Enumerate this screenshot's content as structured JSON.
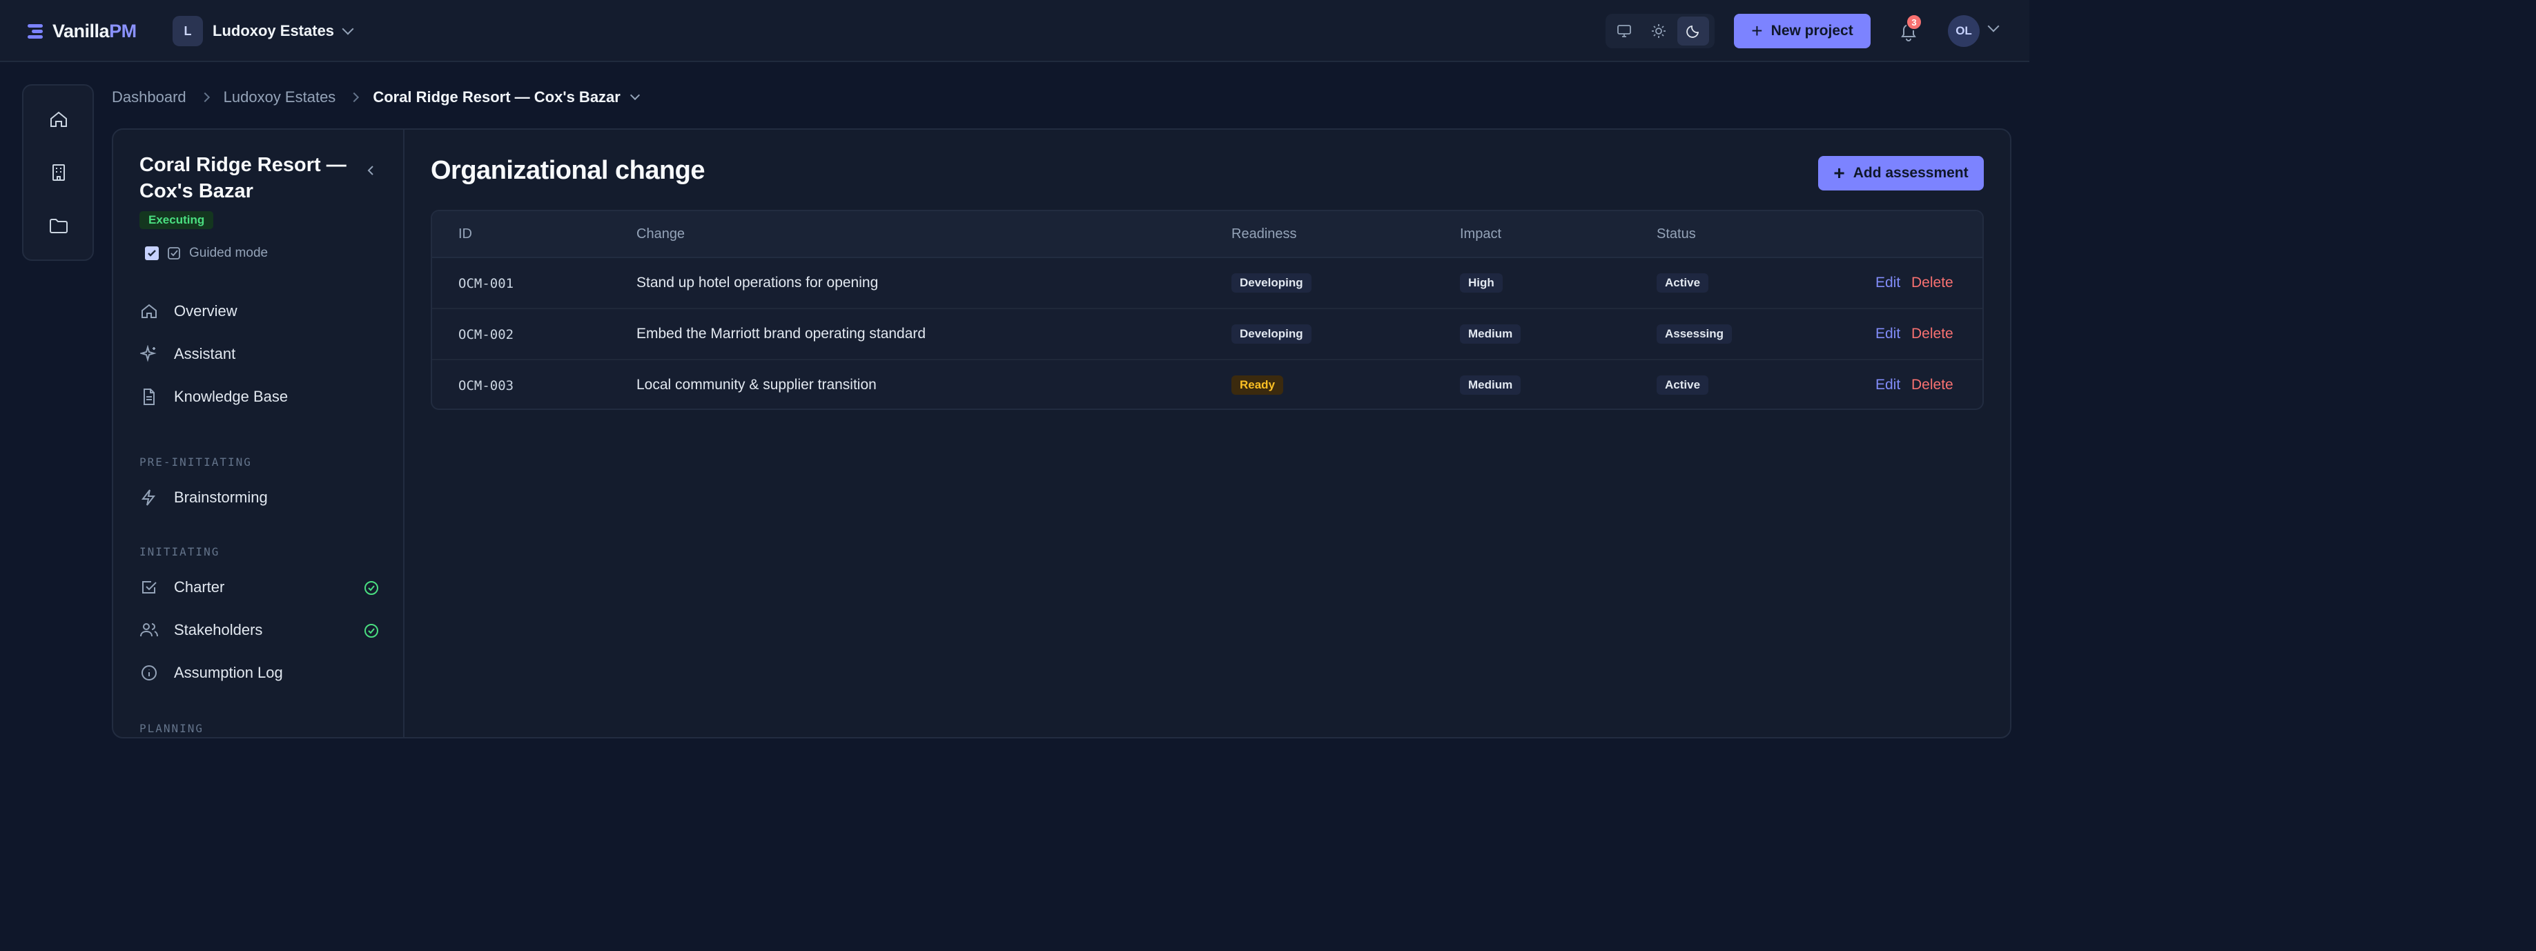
{
  "app": {
    "logo_main": "Vanilla",
    "logo_accent": "PM",
    "org_initial": "L",
    "org_name": "Ludoxoy Estates",
    "new_project_label": "New project",
    "notification_count": "3",
    "user_initials": "OL"
  },
  "breadcrumb": {
    "items": [
      "Dashboard",
      "Ludoxoy Estates"
    ],
    "current": "Coral Ridge Resort — Cox's Bazar"
  },
  "sidebar": {
    "project_title": "Coral Ridge Resort — Cox's Bazar",
    "phase": "Executing",
    "guided_mode_label": "Guided mode",
    "items": [
      {
        "label": "Overview",
        "icon": "home-icon"
      },
      {
        "label": "Assistant",
        "icon": "sparkles-icon"
      },
      {
        "label": "Knowledge Base",
        "icon": "document-icon"
      }
    ],
    "sections": [
      {
        "label": "PRE-INITIATING",
        "items": [
          {
            "label": "Brainstorming",
            "icon": "lightning-icon"
          }
        ]
      },
      {
        "label": "INITIATING",
        "items": [
          {
            "label": "Charter",
            "icon": "checkbox-icon",
            "done": true
          },
          {
            "label": "Stakeholders",
            "icon": "users-icon",
            "done": true
          },
          {
            "label": "Assumption Log",
            "icon": "info-icon"
          }
        ]
      },
      {
        "label": "PLANNING",
        "items": []
      }
    ]
  },
  "main": {
    "title": "Organizational change",
    "add_button_label": "Add assessment",
    "columns": [
      "ID",
      "Change",
      "Readiness",
      "Impact",
      "Status"
    ],
    "rows": [
      {
        "id": "OCM-001",
        "change": "Stand up hotel operations for opening",
        "readiness": "Developing",
        "impact": "High",
        "status": "Active",
        "edit": "Edit",
        "delete": "Delete"
      },
      {
        "id": "OCM-002",
        "change": "Embed the Marriott brand operating standard",
        "readiness": "Developing",
        "impact": "Medium",
        "status": "Assessing",
        "edit": "Edit",
        "delete": "Delete"
      },
      {
        "id": "OCM-003",
        "change": "Local community & supplier transition",
        "readiness": "Ready",
        "impact": "Medium",
        "status": "Active",
        "edit": "Edit",
        "delete": "Delete"
      }
    ]
  },
  "colors": {
    "accent": "#7c83ff",
    "background": "#0f172a",
    "success": "#4ade80",
    "danger": "#f87171",
    "warning": "#fbbf24"
  }
}
